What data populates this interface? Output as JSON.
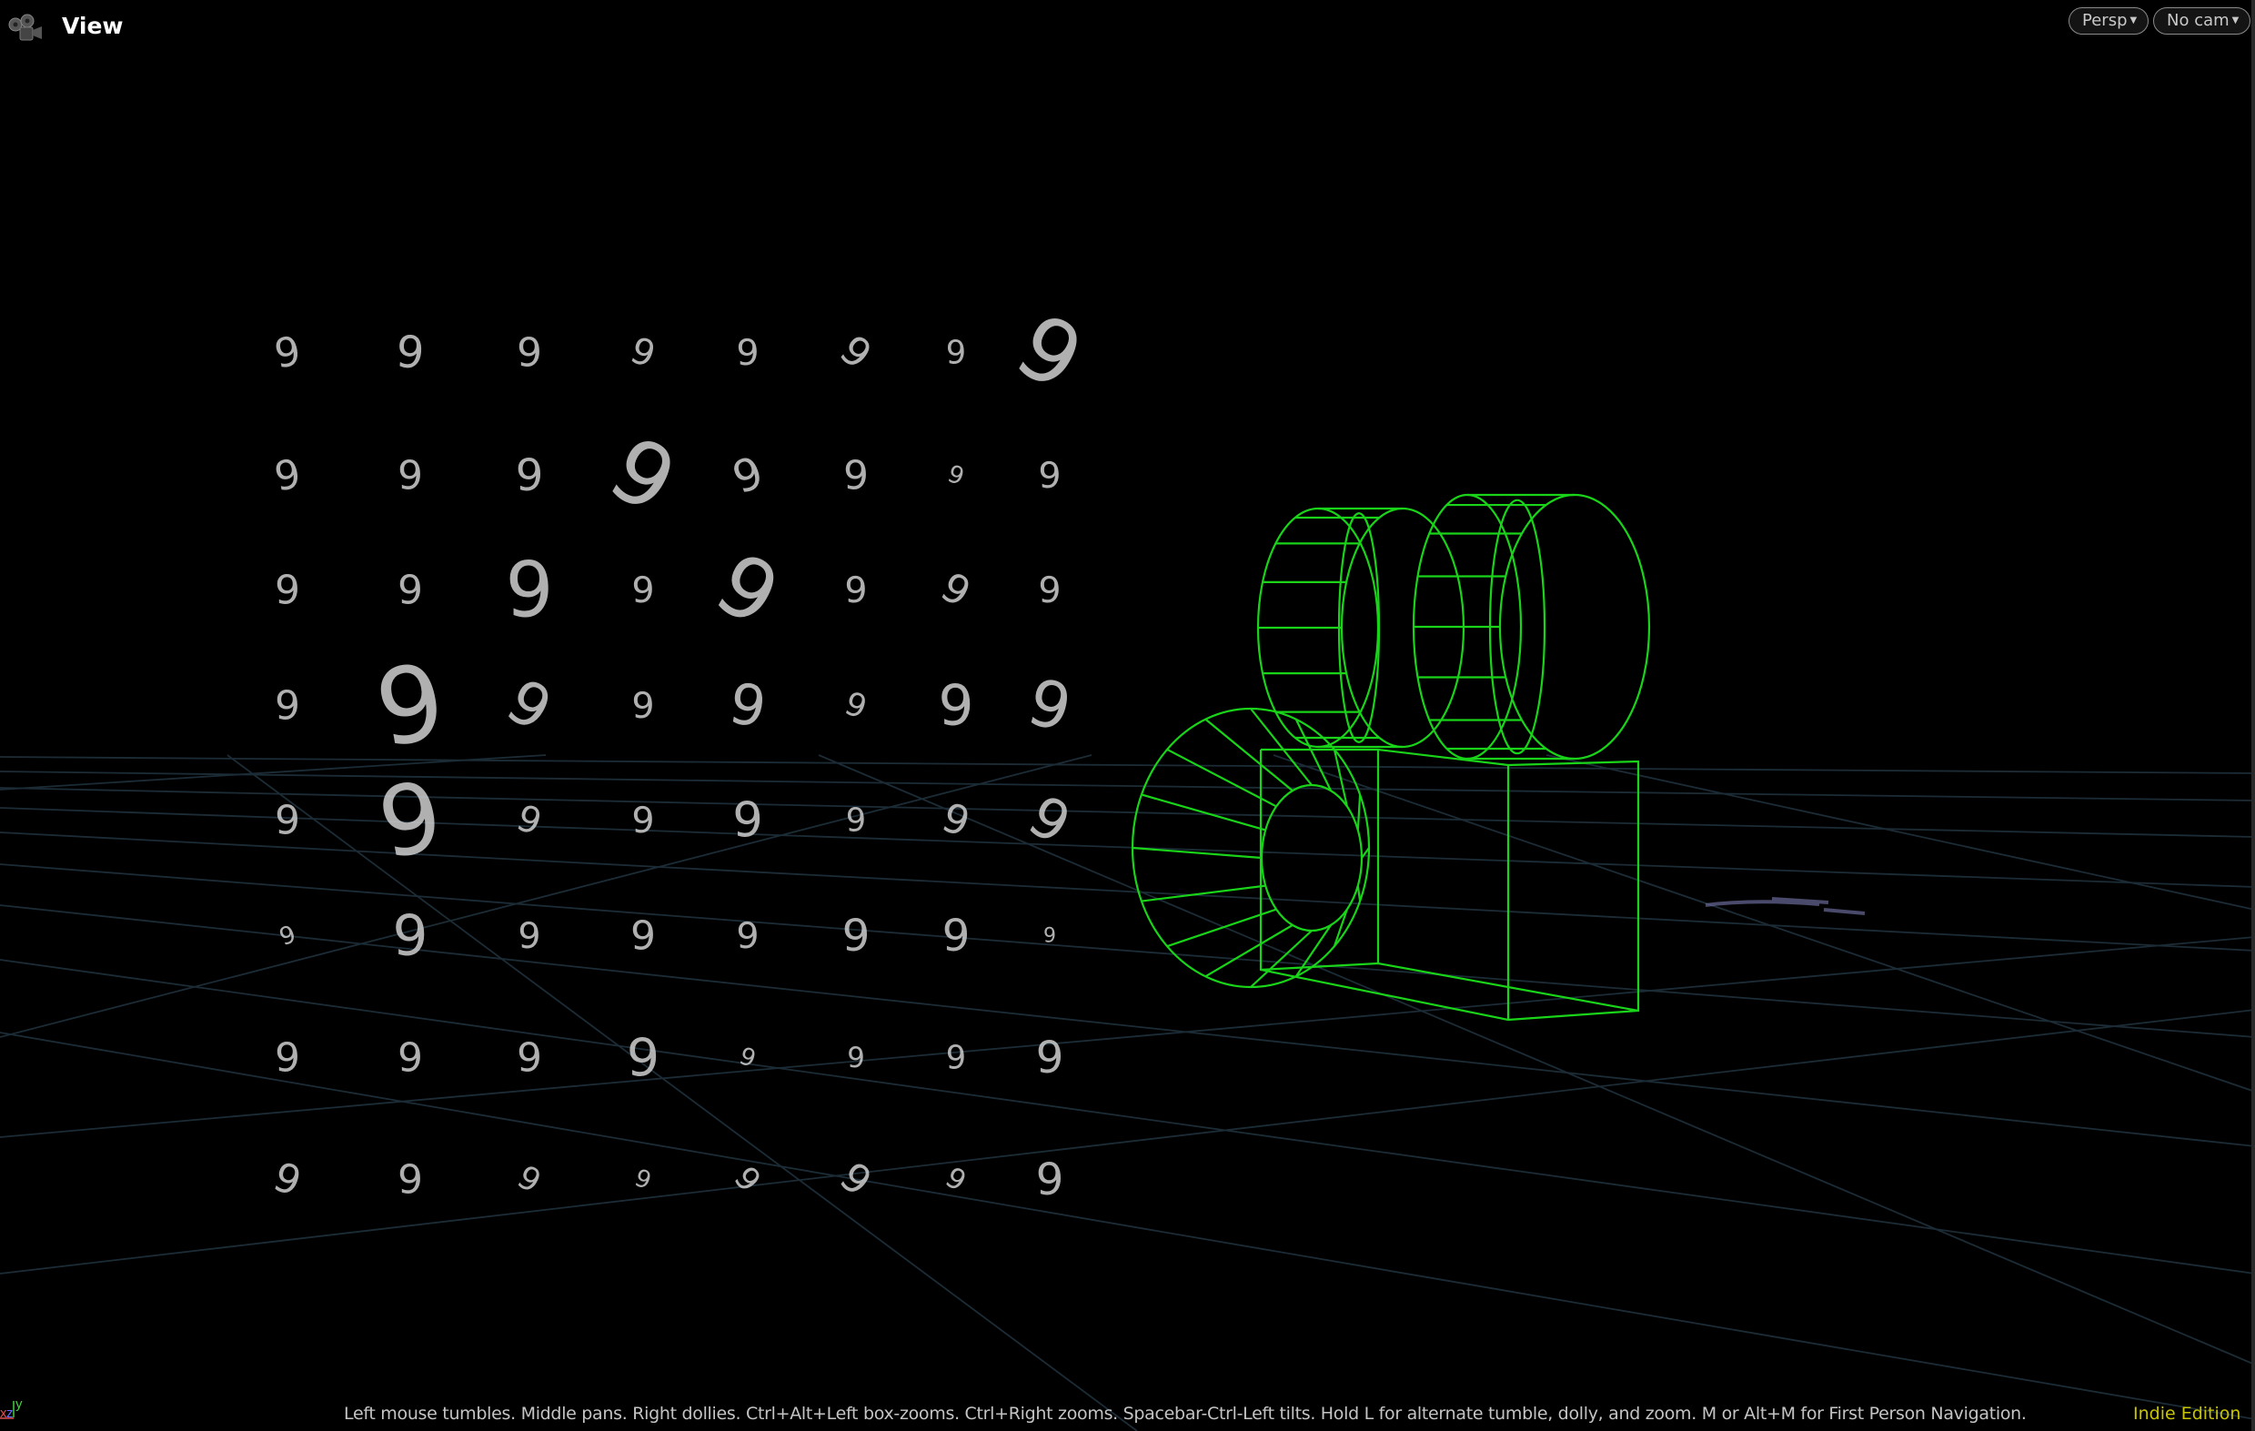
{
  "header": {
    "title": "View",
    "icon": "movie-camera-icon"
  },
  "viewport_controls": {
    "perspective_label": "Persp",
    "camera_label": "No cam"
  },
  "scene": {
    "digit_glyph": "9",
    "wireframe_color": "#19d419",
    "grid_color": "#1c2c36",
    "digit_color": "#cfcfcf"
  },
  "axis_gizmo": {
    "x": "x",
    "y": "y",
    "z": "z",
    "x_color": "#e05050",
    "y_color": "#40d040",
    "z_color": "#6a6aff"
  },
  "status_bar": {
    "hint": "Left mouse tumbles. Middle pans. Right dollies. Ctrl+Alt+Left box-zooms. Ctrl+Right zooms. Spacebar-Ctrl-Left tilts. Hold L for alternate tumble, dolly, and zoom. M or Alt+M for First Person Navigation.",
    "edition": "Indie Edition"
  }
}
